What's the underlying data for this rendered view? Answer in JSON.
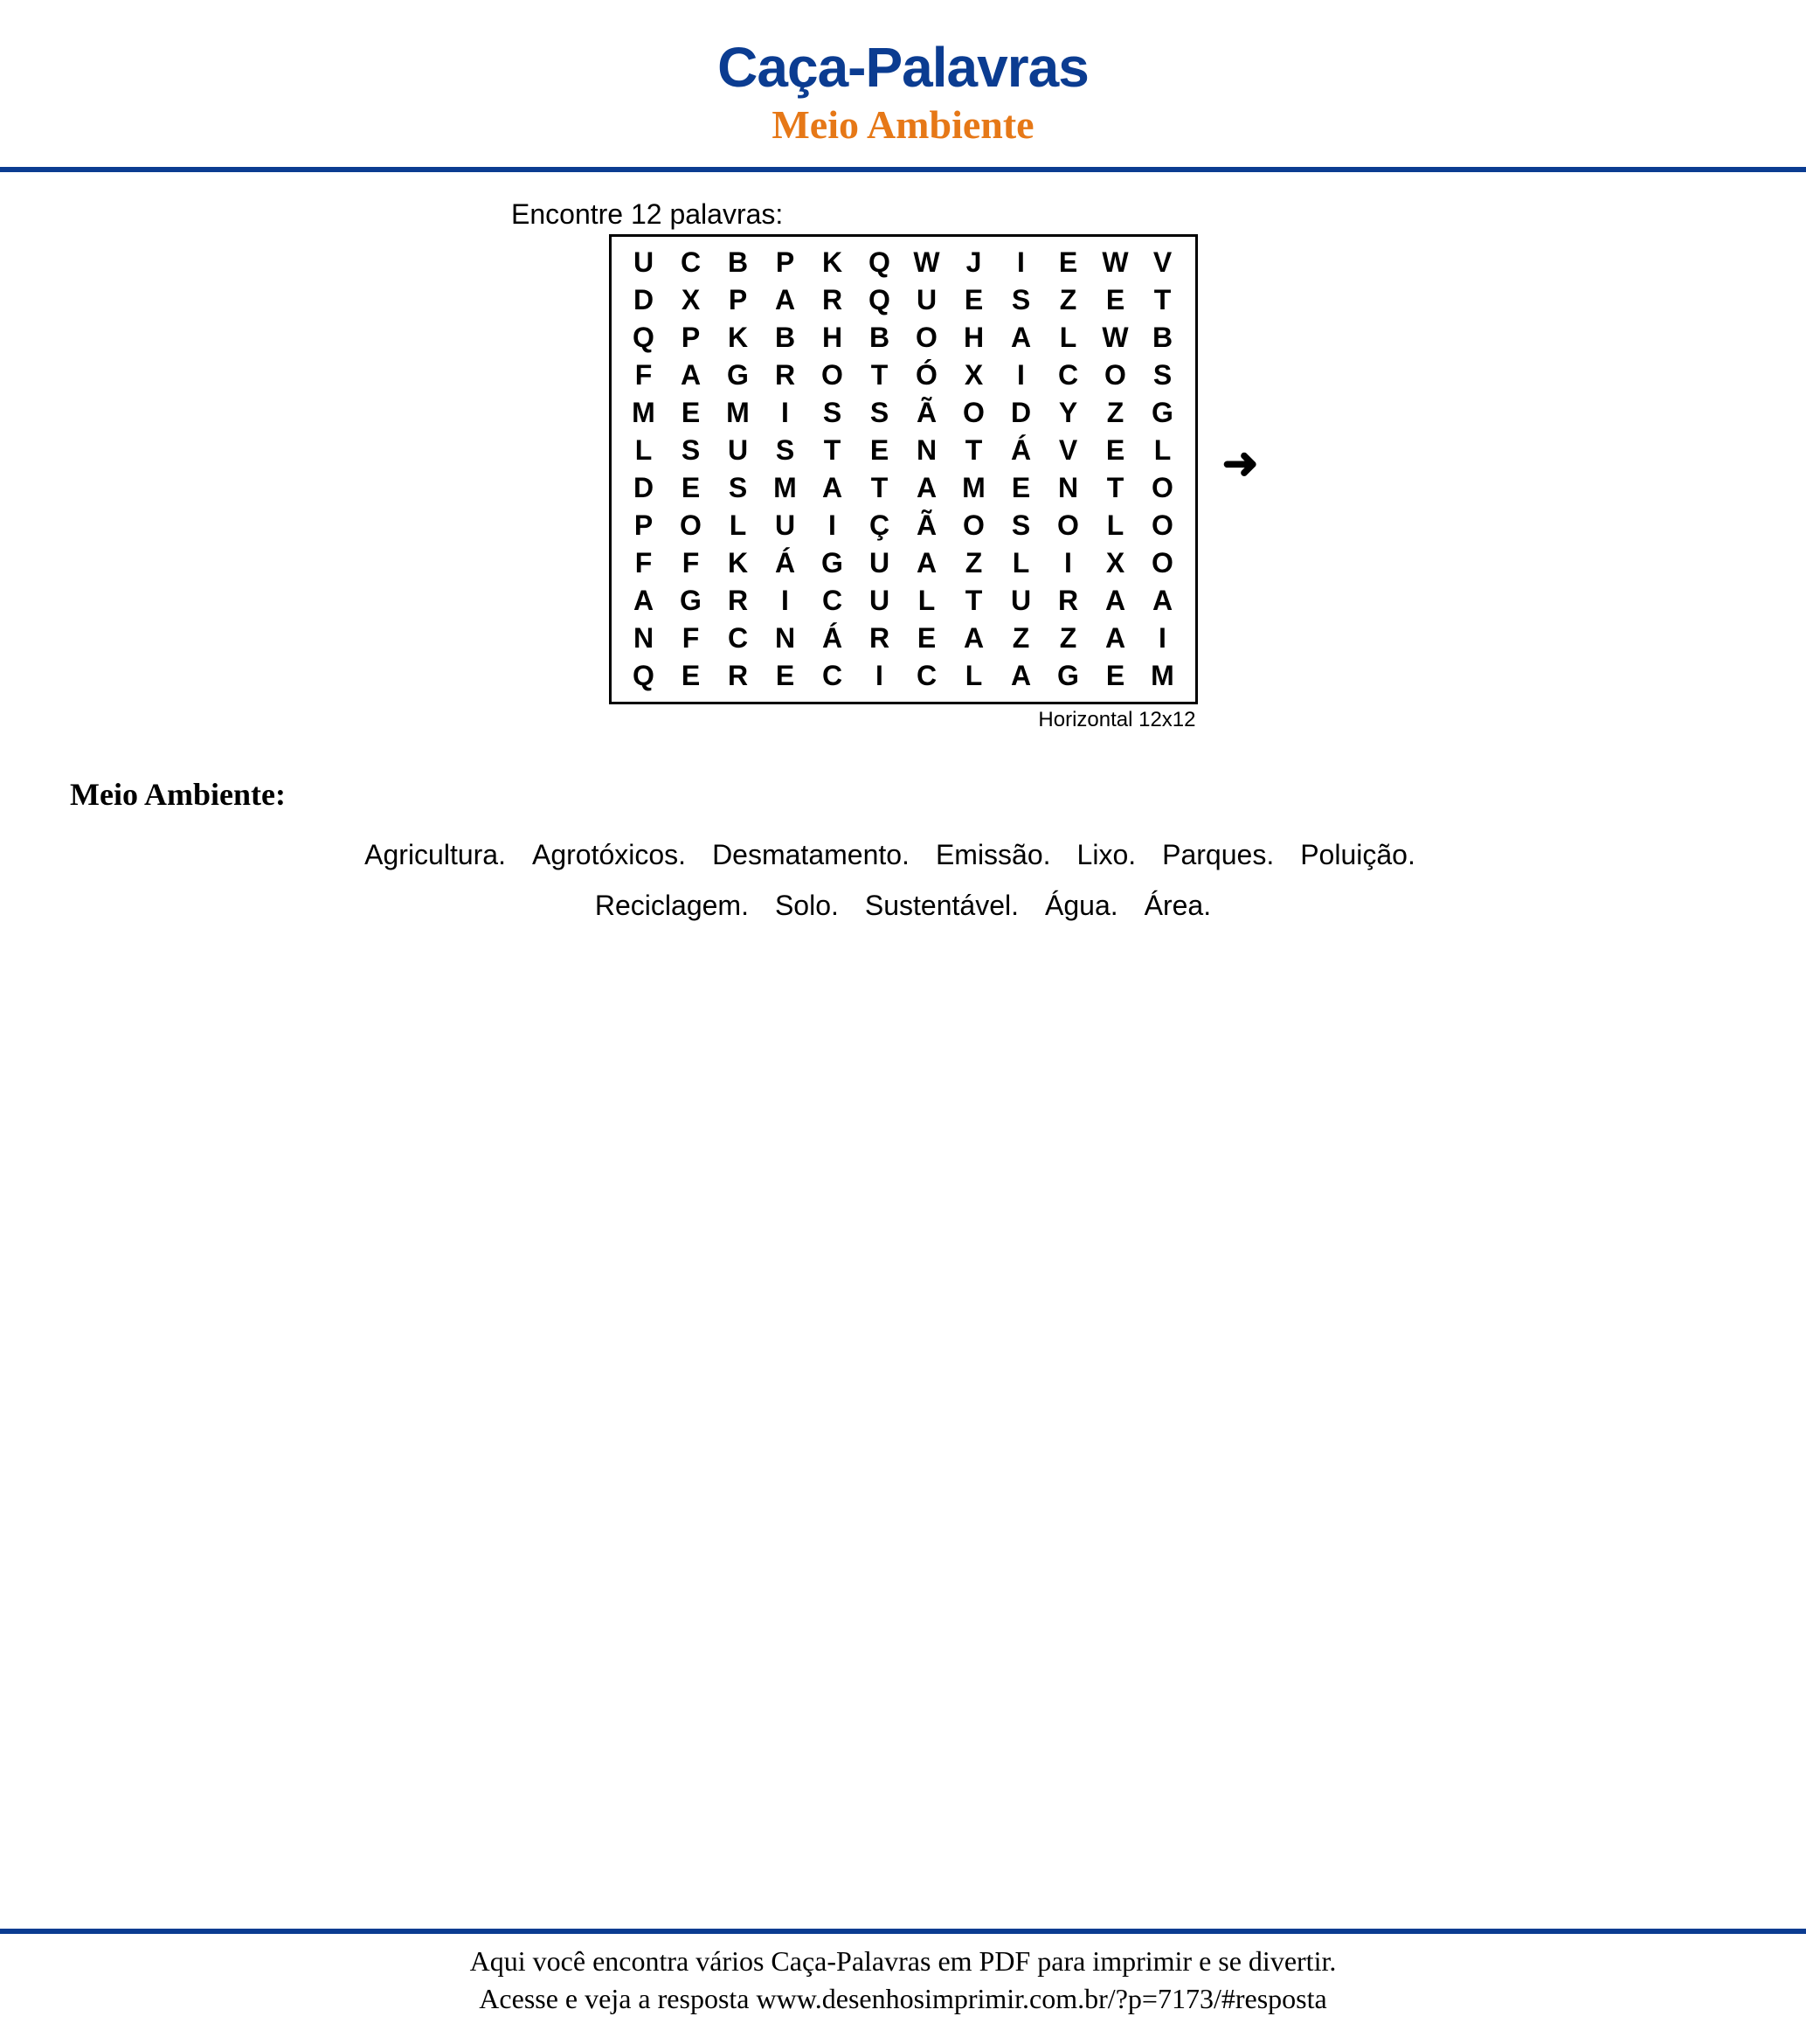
{
  "header": {
    "main_title": "Caça-Palavras",
    "sub_title": "Meio Ambiente"
  },
  "instruction": "Encontre 12 palavras:",
  "grid": {
    "rows": [
      [
        "U",
        "C",
        "B",
        "P",
        "K",
        "Q",
        "W",
        "J",
        "I",
        "E",
        "W",
        "V"
      ],
      [
        "D",
        "X",
        "P",
        "A",
        "R",
        "Q",
        "U",
        "E",
        "S",
        "Z",
        "E",
        "T"
      ],
      [
        "Q",
        "P",
        "K",
        "B",
        "H",
        "B",
        "O",
        "H",
        "A",
        "L",
        "W",
        "B"
      ],
      [
        "F",
        "A",
        "G",
        "R",
        "O",
        "T",
        "Ó",
        "X",
        "I",
        "C",
        "O",
        "S"
      ],
      [
        "M",
        "E",
        "M",
        "I",
        "S",
        "S",
        "Ã",
        "O",
        "D",
        "Y",
        "Z",
        "G"
      ],
      [
        "L",
        "S",
        "U",
        "S",
        "T",
        "E",
        "N",
        "T",
        "Á",
        "V",
        "E",
        "L"
      ],
      [
        "D",
        "E",
        "S",
        "M",
        "A",
        "T",
        "A",
        "M",
        "E",
        "N",
        "T",
        "O"
      ],
      [
        "P",
        "O",
        "L",
        "U",
        "I",
        "Ç",
        "Ã",
        "O",
        "S",
        "O",
        "L",
        "O"
      ],
      [
        "F",
        "F",
        "K",
        "Á",
        "G",
        "U",
        "A",
        "Z",
        "L",
        "I",
        "X",
        "O"
      ],
      [
        "A",
        "G",
        "R",
        "I",
        "C",
        "U",
        "L",
        "T",
        "U",
        "R",
        "A",
        "A"
      ],
      [
        "N",
        "F",
        "C",
        "N",
        "Á",
        "R",
        "E",
        "A",
        "Z",
        "Z",
        "A",
        "I"
      ],
      [
        "Q",
        "E",
        "R",
        "E",
        "C",
        "I",
        "C",
        "L",
        "A",
        "G",
        "E",
        "M"
      ]
    ],
    "caption": "Horizontal 12x12"
  },
  "arrow_glyph": "➜",
  "category_label": "Meio Ambiente:",
  "words": [
    "Agricultura.",
    "Agrotóxicos.",
    "Desmatamento.",
    "Emissão.",
    "Lixo.",
    "Parques.",
    "Poluição.",
    "Reciclagem.",
    "Solo.",
    "Sustentável.",
    "Água.",
    "Área."
  ],
  "footer": {
    "line1": "Aqui você encontra vários Caça-Palavras em PDF para imprimir e se divertir.",
    "line2": "Acesse e veja a resposta  www.desenhosimprimir.com.br/?p=7173/#resposta"
  }
}
